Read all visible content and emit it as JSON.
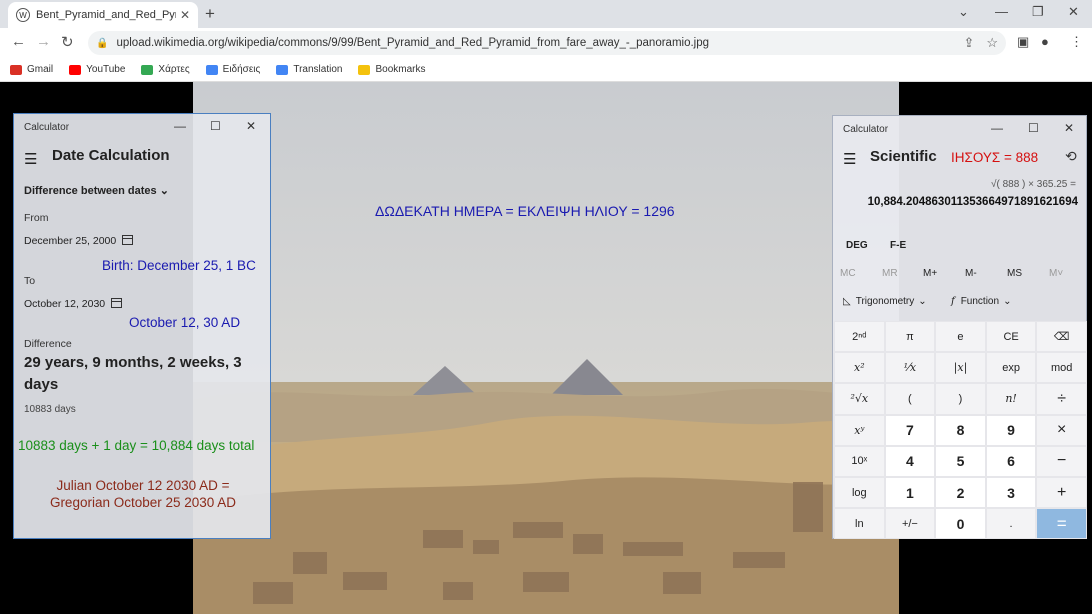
{
  "browser": {
    "tab_title": "Bent_Pyramid_and_Red_Pyramid",
    "tab_close": "✕",
    "new_tab": "+",
    "url": "upload.wikimedia.org/wikipedia/commons/9/99/Bent_Pyramid_and_Red_Pyramid_from_fare_away_-_panoramio.jpg",
    "bookmarks": [
      {
        "label": "Gmail",
        "color": "#d93025"
      },
      {
        "label": "YouTube",
        "color": "#ff0000"
      },
      {
        "label": "Χάρτες",
        "color": "#34a853"
      },
      {
        "label": "Ειδήσεις",
        "color": "#4285f4"
      },
      {
        "label": "Translation",
        "color": "#4285f4"
      },
      {
        "label": "Bookmarks",
        "color": "#f4c20d"
      }
    ]
  },
  "photo_overlay": {
    "text": "ΔΩΔΕΚΑΤΗ ΗΜΕΡΑ = ΕΚΛΕΙΨΗ ΗΛΙΟΥ = 1296"
  },
  "date_calc": {
    "window_title": "Calculator",
    "heading": "Date Calculation",
    "mode": "Difference between dates",
    "from_label": "From",
    "from_date": "December 25, 2000",
    "birth_note": "Birth: December 25, 1 BC",
    "to_label": "To",
    "to_date": "October 12, 2030",
    "to_note": "October 12, 30 AD",
    "difference_label": "Difference",
    "difference": "29 years, 9 months, 2 weeks, 3 days",
    "days": "10883 days",
    "total_note": "10883 days + 1 day = 10,884 days total",
    "julian_note": "Julian October 12 2030 AD =",
    "gregorian_note": "Gregorian October 25 2030 AD"
  },
  "scientific": {
    "window_title": "Calculator",
    "heading": "Scientific",
    "red_note": "ΙΗΣΟΥΣ = 888",
    "expression": "√( 888 ) × 365.25 =",
    "result": "10,884.204863011353664971891621694",
    "angle_mode": "DEG",
    "fe": "F-E",
    "memory": [
      {
        "label": "MC",
        "enabled": false
      },
      {
        "label": "MR",
        "enabled": false
      },
      {
        "label": "M+",
        "enabled": true
      },
      {
        "label": "M-",
        "enabled": true
      },
      {
        "label": "MS",
        "enabled": true
      },
      {
        "label": "M˅",
        "enabled": false
      }
    ],
    "trig_label": "Trigonometry",
    "function_label": "Function",
    "keys": [
      [
        "2ⁿᵈ",
        "π",
        "e",
        "CE",
        "⌫"
      ],
      [
        "x²",
        "¹⁄x",
        "|x|",
        "exp",
        "mod"
      ],
      [
        "²√x",
        "(",
        ")",
        "n!",
        "÷"
      ],
      [
        "xʸ",
        "7",
        "8",
        "9",
        "×"
      ],
      [
        "10ˣ",
        "4",
        "5",
        "6",
        "−"
      ],
      [
        "log",
        "1",
        "2",
        "3",
        "+"
      ],
      [
        "ln",
        "+/−",
        "0",
        ".",
        "="
      ]
    ]
  }
}
